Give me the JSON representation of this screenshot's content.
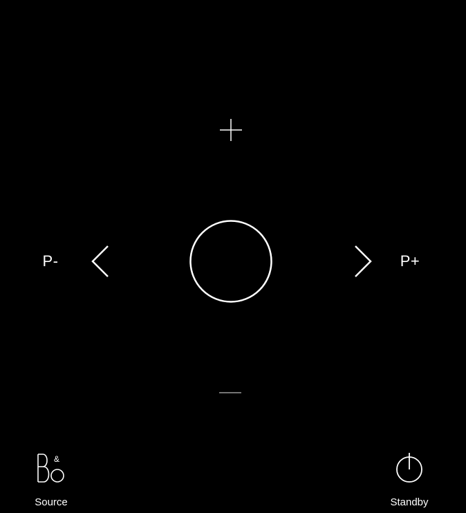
{
  "remote": {
    "volume_up_icon": "plus-icon",
    "volume_down_icon": "minus-icon",
    "center_icon": "circle-icon",
    "prev_icon": "chevron-left-icon",
    "next_icon": "chevron-right-icon",
    "program_down_label": "P-",
    "program_up_label": "P+"
  },
  "bottom_bar": {
    "source_label": "Source",
    "source_icon": "bang-olufsen-logo-icon",
    "standby_label": "Standby",
    "standby_icon": "power-icon"
  },
  "colors": {
    "background": "#000000",
    "foreground": "#ffffff",
    "muted": "#9a9a9a"
  }
}
